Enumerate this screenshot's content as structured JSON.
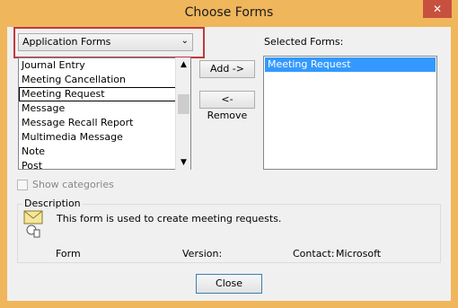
{
  "window": {
    "title": "Choose Forms",
    "close_glyph": "✕"
  },
  "dropdown": {
    "value": "Application Forms",
    "chevron": "⌄"
  },
  "forms_list": {
    "items": [
      {
        "label": "Journal Entry"
      },
      {
        "label": "Meeting Cancellation"
      },
      {
        "label": "Meeting Request"
      },
      {
        "label": "Message"
      },
      {
        "label": "Message Recall Report"
      },
      {
        "label": "Multimedia Message"
      },
      {
        "label": "Note"
      },
      {
        "label": "Post"
      }
    ],
    "focused_index": 2
  },
  "buttons": {
    "add": "Add ->",
    "remove": "<- Remove",
    "close": "Close"
  },
  "selected": {
    "label": "Selected Forms:",
    "items": [
      "Meeting Request"
    ]
  },
  "checkbox": {
    "label": "Show categories",
    "checked": false
  },
  "description": {
    "label": "Description",
    "text": "This form is used to create meeting requests.",
    "form_label": "Form",
    "version_label": "Version:",
    "contact_label": "Contact:",
    "contact_value": "Microsoft"
  }
}
